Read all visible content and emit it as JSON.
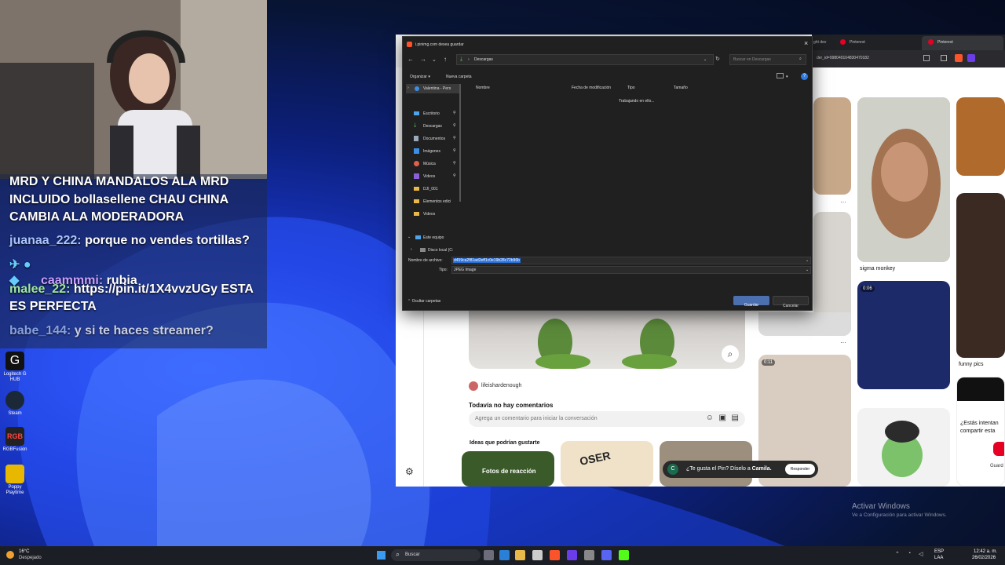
{
  "chat": {
    "lines": [
      {
        "user": "",
        "text": "MRD Y CHINA MANDALOS ALA MRD"
      },
      {
        "user": "",
        "text": "INCLUIDO bollasellene CHAU CHINA"
      },
      {
        "user": "",
        "text": "CAMBIA ALA MODERADORA"
      },
      {
        "user": "juanaa_222:",
        "text": "porque no vendes tortillas?"
      },
      {
        "user": "caammmi:",
        "text": "rubia"
      },
      {
        "user": "malee_22:",
        "text": "https://pin.it/1X4vvzUGy ESTA"
      },
      {
        "user": "",
        "text": "ES PERFECTA"
      },
      {
        "user": "babe_144:",
        "text": "y si te haces streamer?"
      }
    ]
  },
  "desktop_icons": [
    {
      "label": "Logitech G HUB",
      "icon": "logitech-icon",
      "color": "#111111"
    },
    {
      "label": "Steam",
      "icon": "steam-icon",
      "color": "#1b2838"
    },
    {
      "label": "RGBFusion",
      "icon": "rgbfusion-icon",
      "color": "#222222"
    },
    {
      "label": "Poppy Playtime",
      "icon": "poppy-icon",
      "color": "#e8b800"
    }
  ],
  "dialog": {
    "title": "i.pinimg.com desea guardar",
    "path": "Descargas",
    "search_placeholder": "Buscar en Descargas",
    "organize": "Organizar",
    "new_folder": "Nueva carpeta",
    "columns": [
      "Nombre",
      "Fecha de modificación",
      "Tipo",
      "Tamaño"
    ],
    "working": "Trabajando en ello...",
    "tree": [
      {
        "label": "Valentina - Pers",
        "icon": "cloud-icon"
      },
      {
        "label": "Escritorio",
        "icon": "desktop-icon"
      },
      {
        "label": "Descargas",
        "icon": "download-icon"
      },
      {
        "label": "Documentos",
        "icon": "document-icon"
      },
      {
        "label": "Imágenes",
        "icon": "images-icon"
      },
      {
        "label": "Música",
        "icon": "music-icon"
      },
      {
        "label": "Videos",
        "icon": "video-icon"
      },
      {
        "label": "DJI_001",
        "icon": "folder-icon"
      },
      {
        "label": "Elementos edici",
        "icon": "folder-icon"
      },
      {
        "label": "Videos",
        "icon": "folder-icon"
      },
      {
        "label": "Este equipo",
        "icon": "pc-icon"
      },
      {
        "label": "Disco local (C:",
        "icon": "drive-icon"
      }
    ],
    "filename_label": "Nombre de archivo:",
    "filename_value": "d459ca2f81ad2eff1c0e19b28c72b96b",
    "type_label": "Tipo:",
    "type_value": "JPEG Image",
    "hide_folders": "Ocultar carpetas",
    "save": "Guardar",
    "cancel": "Cancelar"
  },
  "browser": {
    "tabs": [
      "ght dev",
      "Pinterest",
      "Pinterest"
    ],
    "address": "der_id=998040104830470182",
    "author": "lifeishardenough",
    "no_comments": "Todavía no hay comentarios",
    "comment_placeholder": "Agrega un comentario para iniciar la conversación",
    "related_title": "Ideas que podrían gustarte",
    "related": [
      "Fotos de reacción",
      "OSER"
    ],
    "toast_avatar": "C",
    "toast_text": "¿Te gusta el Pin? Díselo a",
    "toast_name": "Camila.",
    "toast_button": "Responder",
    "pin_captions": [
      "sigma monkey",
      "funny pics"
    ],
    "badges": [
      "0:06",
      "0:11"
    ],
    "side_card": "¿Estás intentan compartir esta",
    "side_card_btn": "Guard"
  },
  "watermark": {
    "title": "Activar Windows",
    "subtitle": "Ve a Configuración para activar Windows."
  },
  "taskbar": {
    "temp": "16°C",
    "weather": "Despejado",
    "search": "Buscar",
    "lang": "ESP",
    "lang2": "LAA",
    "time": "12:42 a. m.",
    "date": "26/02/2026"
  }
}
